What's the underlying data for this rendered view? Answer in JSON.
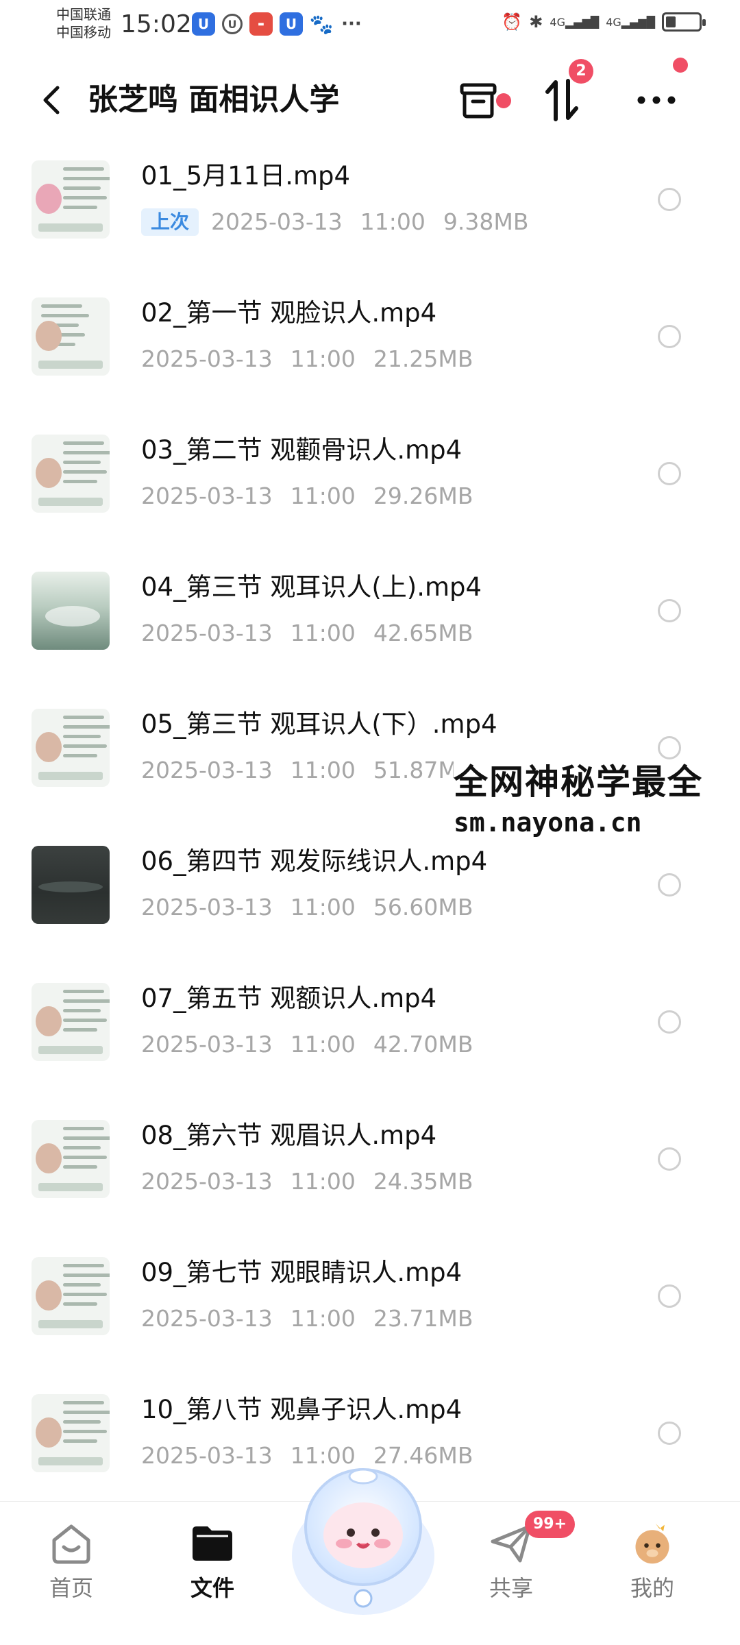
{
  "status_bar": {
    "carrier1": "中国联通",
    "carrier2": "中国移动",
    "time": "15:02",
    "more": "···",
    "network1": "4G",
    "network2": "4G",
    "battery_level": 0.3
  },
  "header": {
    "title": "张芝鸣 面相识人学",
    "sort_badge": "2"
  },
  "files": [
    {
      "name": "01_5月11日.mp4",
      "tag": "上次",
      "date": "2025-03-13",
      "time": "11:00",
      "size": "9.38MB"
    },
    {
      "name": "02_第一节 观脸识人.mp4",
      "date": "2025-03-13",
      "time": "11:00",
      "size": "21.25MB"
    },
    {
      "name": "03_第二节 观颧骨识人.mp4",
      "date": "2025-03-13",
      "time": "11:00",
      "size": "29.26MB"
    },
    {
      "name": "04_第三节 观耳识人(上).mp4",
      "date": "2025-03-13",
      "time": "11:00",
      "size": "42.65MB"
    },
    {
      "name": "05_第三节 观耳识人(下）.mp4",
      "date": "2025-03-13",
      "time": "11:00",
      "size": "51.87MB"
    },
    {
      "name": "06_第四节 观发际线识人.mp4",
      "date": "2025-03-13",
      "time": "11:00",
      "size": "56.60MB"
    },
    {
      "name": "07_第五节 观额识人.mp4",
      "date": "2025-03-13",
      "time": "11:00",
      "size": "42.70MB"
    },
    {
      "name": "08_第六节 观眉识人.mp4",
      "date": "2025-03-13",
      "time": "11:00",
      "size": "24.35MB"
    },
    {
      "name": "09_第七节 观眼睛识人.mp4",
      "date": "2025-03-13",
      "time": "11:00",
      "size": "23.71MB"
    },
    {
      "name": "10_第八节 观鼻子识人.mp4",
      "date": "2025-03-13",
      "time": "11:00",
      "size": "27.46MB"
    }
  ],
  "watermark": {
    "line1": "全网神秘学最全",
    "line2": "sm.nayona.cn"
  },
  "bottom_nav": {
    "home": "首页",
    "files": "文件",
    "share": "共享",
    "share_badge": "99+",
    "mine": "我的"
  },
  "colors": {
    "accent_blue": "#3b8ae0",
    "badge_red": "#f04e65",
    "meta_gray": "#a6a6a6"
  }
}
